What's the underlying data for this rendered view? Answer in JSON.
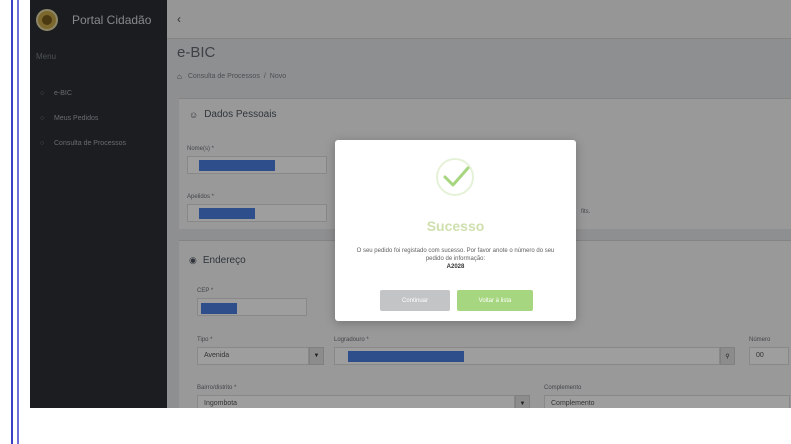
{
  "sidebar": {
    "brand": "Portal Cidadão",
    "menu_header": "Menu",
    "items": [
      {
        "label": "e-BIC",
        "icon": "bullet-icon"
      },
      {
        "label": "Meus Pedidos",
        "icon": "bullet-icon"
      },
      {
        "label": "Consulta de Processos",
        "icon": "bullet-icon"
      }
    ]
  },
  "topbar": {
    "toggle": "‹"
  },
  "page": {
    "title": "e-BIC",
    "breadcrumb": [
      "Consulta de Processos",
      "Novo"
    ]
  },
  "card_personal": {
    "title": "Dados Pessoais",
    "fields": [
      {
        "label": "Nome(s) *"
      },
      {
        "label": "Apelidos *"
      }
    ],
    "right_snippet": "fits."
  },
  "card_address": {
    "title": "Endereço",
    "fields": {
      "cep_label": "CEP *",
      "tipo_label": "Tipo *",
      "tipo_value": "Avenida",
      "logradouro_label": "Logradouro *",
      "numero_label": "Número",
      "numero_value": "00",
      "bairro_label": "Bairro/distrito *",
      "bairro_value": "Ingombota",
      "complemento_label": "Complemento",
      "complemento_value": "Complemento"
    }
  },
  "modal": {
    "title": "Sucesso",
    "message": "O seu pedido foi registado com sucesso. Por favor anote o número do seu pedido de informação:",
    "protocol": "A2028",
    "continue_label": "Continuar",
    "view_label": "Voltar à lista"
  },
  "colors": {
    "sidebar": "#2c3035",
    "success": "#a7d680",
    "redaction": "#4a7fe0"
  }
}
